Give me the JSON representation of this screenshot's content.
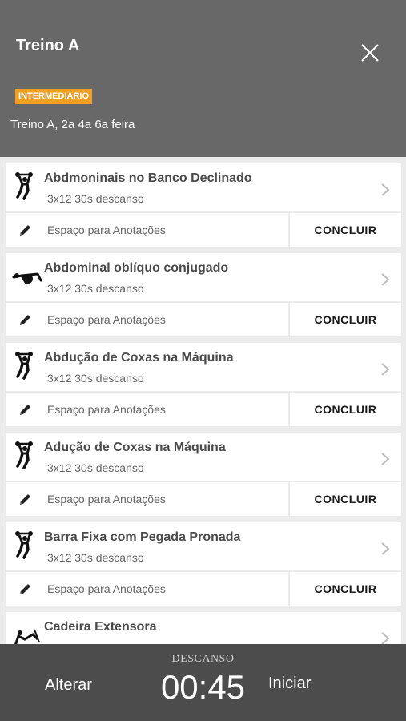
{
  "header": {
    "title": "Treino A",
    "level_badge": "INTERMEDIÁRIO",
    "subtitle": "Treino A, 2a 4a 6a feira",
    "badge_color": "#f0a020"
  },
  "exercises": [
    {
      "name": "Abdmoninais no Banco Declinado",
      "detail": "3x12 30s descanso",
      "icon": "standing-exercise-icon",
      "notes_placeholder": "Espaço para Anotações",
      "done_label": "CONCLUIR"
    },
    {
      "name": "Abdominal oblíquo conjugado",
      "detail": "3x12 30s descanso",
      "icon": "lying-exercise-icon",
      "notes_placeholder": "Espaço para Anotações",
      "done_label": "CONCLUIR"
    },
    {
      "name": "Abdução de Coxas na Máquina",
      "detail": "3x12 30s descanso",
      "icon": "standing-exercise-icon",
      "notes_placeholder": "Espaço para Anotações",
      "done_label": "CONCLUIR"
    },
    {
      "name": "Adução de Coxas na Máquina",
      "detail": "3x12 30s descanso",
      "icon": "standing-exercise-icon",
      "notes_placeholder": "Espaço para Anotações",
      "done_label": "CONCLUIR"
    },
    {
      "name": "Barra Fixa com Pegada Pronada",
      "detail": "3x12 30s descanso",
      "icon": "standing-exercise-icon",
      "notes_placeholder": "Espaço para Anotações",
      "done_label": "CONCLUIR"
    },
    {
      "name": "Cadeira Extensora",
      "detail": "",
      "icon": "seated-exercise-icon",
      "notes_placeholder": "",
      "done_label": ""
    }
  ],
  "footer": {
    "left_label": "Alterar",
    "rest_label": "DESCANSO",
    "timer": "00:45",
    "right_label": "Iniciar"
  }
}
